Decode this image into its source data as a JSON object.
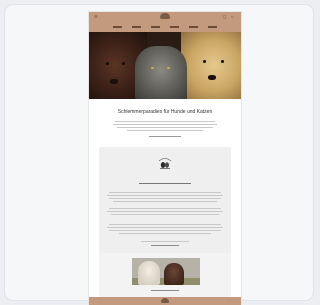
{
  "site": {
    "headline": "Schlemmerparadies für Hunde und Katzen",
    "colors": {
      "header": "#c39a7e",
      "background": "#ffffff",
      "panel": "#efefef"
    },
    "icons": [
      "menu-icon",
      "cart-icon",
      "logo-icon",
      "emblem-icon"
    ]
  }
}
